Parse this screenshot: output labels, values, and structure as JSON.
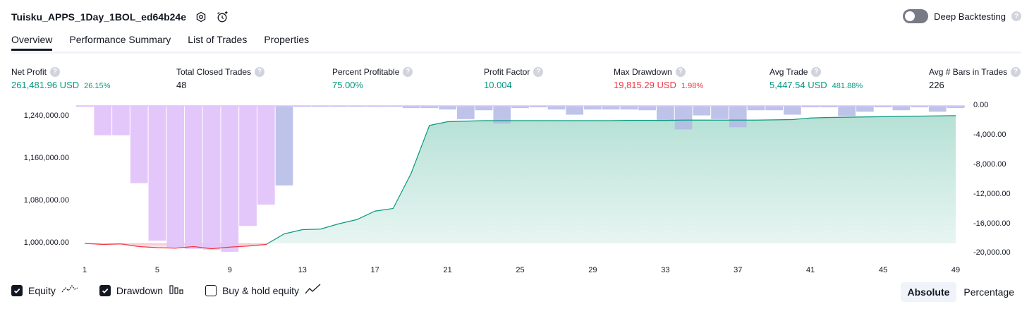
{
  "header": {
    "title": "Tuisku_APPS_1Day_1BOL_ed64b24e",
    "deep_backtesting_label": "Deep Backtesting",
    "help_glyph": "?"
  },
  "tabs": [
    {
      "label": "Overview",
      "active": true
    },
    {
      "label": "Performance Summary",
      "active": false
    },
    {
      "label": "List of Trades",
      "active": false
    },
    {
      "label": "Properties",
      "active": false
    }
  ],
  "metrics": [
    {
      "label": "Net Profit",
      "value": "261,481.96 USD",
      "pct": "26.15%",
      "color": "#089981"
    },
    {
      "label": "Total Closed Trades",
      "value": "48",
      "pct": "",
      "color": "#131722"
    },
    {
      "label": "Percent Profitable",
      "value": "75.00%",
      "pct": "",
      "color": "#089981"
    },
    {
      "label": "Profit Factor",
      "value": "10.004",
      "pct": "",
      "color": "#089981"
    },
    {
      "label": "Max Drawdown",
      "value": "19,815.29 USD",
      "pct": "1.98%",
      "color": "#f23645"
    },
    {
      "label": "Avg Trade",
      "value": "5,447.54 USD",
      "pct": "481.88%",
      "color": "#089981"
    },
    {
      "label": "Avg # Bars in Trades",
      "value": "226",
      "pct": "",
      "color": "#131722"
    }
  ],
  "colors": {
    "equity_line": "#089981",
    "equity_fill": "#b2dfd3",
    "drawdown_bar": "#e1c4fb",
    "drawdown_overlap": "#b3b8e6",
    "loss_line": "#f23645"
  },
  "chart_data": {
    "type": "area",
    "x_ticks": [
      "1",
      "5",
      "9",
      "13",
      "17",
      "21",
      "25",
      "29",
      "33",
      "37",
      "41",
      "45",
      "49"
    ],
    "equity_axis": {
      "ticks": [
        "1,240,000.00",
        "1,160,000.00",
        "1,080,000.00",
        "1,000,000.00"
      ],
      "range": [
        1000000,
        1261482
      ]
    },
    "drawdown_axis": {
      "ticks": [
        "0.00",
        "-4,000.00",
        "-8,000.00",
        "-12,000.00",
        "-16,000.00",
        "-20,000.00"
      ],
      "range": [
        -20000,
        0
      ]
    },
    "series": [
      {
        "name": "Equity",
        "values": [
          1000000,
          998000,
          999000,
          994000,
          992000,
          991000,
          994000,
          990000,
          993000,
          995000,
          998000,
          1018000,
          1026000,
          1027000,
          1037000,
          1045000,
          1061000,
          1066000,
          1133000,
          1223000,
          1230000,
          1231000,
          1232000,
          1232000,
          1232000,
          1232000,
          1232000,
          1232000,
          1232000,
          1232000,
          1232500,
          1232500,
          1232500,
          1233000,
          1233000,
          1233000,
          1233000,
          1233000,
          1233500,
          1234000,
          1237000,
          1238000,
          1238500,
          1239000,
          1239500,
          1240000,
          1240500,
          1241000,
          1241500
        ]
      },
      {
        "name": "Drawdown",
        "values": [
          -100,
          -4000,
          -4000,
          -10500,
          -18300,
          -19200,
          -19400,
          -19500,
          -19800,
          -16300,
          -13400,
          -10800,
          -100,
          -100,
          -100,
          -100,
          -100,
          -100,
          -300,
          -300,
          -500,
          -1800,
          -600,
          -2400,
          -300,
          -200,
          -500,
          -1200,
          -500,
          -500,
          -500,
          -600,
          -2100,
          -3200,
          -1300,
          -1800,
          -2900,
          -600,
          -600,
          -1200,
          -200,
          -200,
          -1400,
          -800,
          -200,
          -600,
          -200,
          -800,
          -300
        ]
      }
    ]
  },
  "legend": {
    "equity": "Equity",
    "drawdown": "Drawdown",
    "buy_hold": "Buy & hold equity"
  },
  "view_toggle": {
    "absolute": "Absolute",
    "percentage": "Percentage"
  }
}
